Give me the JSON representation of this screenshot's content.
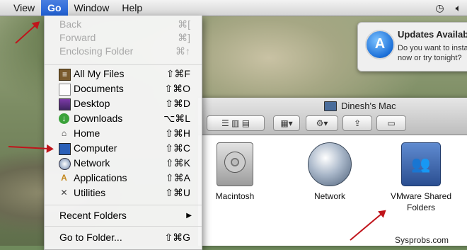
{
  "menubar": {
    "items": [
      "View",
      "Go",
      "Window",
      "Help"
    ],
    "active": "Go"
  },
  "notification": {
    "title": "Updates Availab",
    "line1": "Do you want to insta",
    "line2": "now or try tonight?"
  },
  "go_menu": {
    "back": {
      "label": "Back",
      "shortcut": "⌘["
    },
    "forward": {
      "label": "Forward",
      "shortcut": "⌘]"
    },
    "enclosing": {
      "label": "Enclosing Folder",
      "shortcut": "⌘↑"
    },
    "places": [
      {
        "label": "All My Files",
        "shortcut": "⇧⌘F"
      },
      {
        "label": "Documents",
        "shortcut": "⇧⌘O"
      },
      {
        "label": "Desktop",
        "shortcut": "⇧⌘D"
      },
      {
        "label": "Downloads",
        "shortcut": "⌥⌘L"
      },
      {
        "label": "Home",
        "shortcut": "⇧⌘H"
      },
      {
        "label": "Computer",
        "shortcut": "⇧⌘C"
      },
      {
        "label": "Network",
        "shortcut": "⇧⌘K"
      },
      {
        "label": "Applications",
        "shortcut": "⇧⌘A"
      },
      {
        "label": "Utilities",
        "shortcut": "⇧⌘U"
      }
    ],
    "recent_folders": "Recent Folders",
    "go_to_folder": {
      "label": "Go to Folder...",
      "shortcut": "⇧⌘G"
    }
  },
  "finder": {
    "title": "Dinesh's Mac",
    "items": [
      {
        "label": "Macintosh"
      },
      {
        "label": "Network"
      },
      {
        "label": "VMware Shared Folders"
      }
    ]
  },
  "watermark": "Sysprobs.com"
}
